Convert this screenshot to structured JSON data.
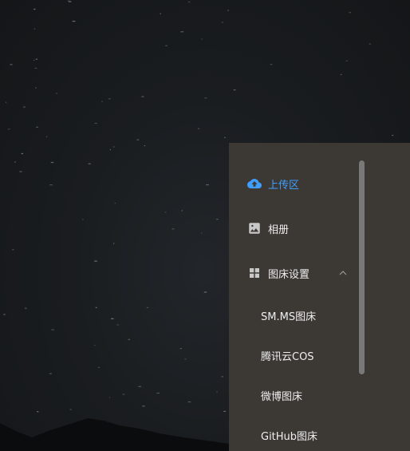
{
  "menu": {
    "upload": {
      "label": "上传区",
      "icon": "cloud-upload-icon"
    },
    "album": {
      "label": "相册",
      "icon": "image-icon"
    },
    "settings": {
      "label": "图床设置",
      "icon": "grid-icon",
      "expanded": true
    },
    "sub_items": [
      {
        "label": "SM.MS图床"
      },
      {
        "label": "腾讯云COS"
      },
      {
        "label": "微博图床"
      },
      {
        "label": "GitHub图床"
      }
    ]
  },
  "colors": {
    "accent": "#409eff",
    "panel_bg": "#3c3935",
    "text": "#eeeeee",
    "icon": "#c8c8c8"
  }
}
